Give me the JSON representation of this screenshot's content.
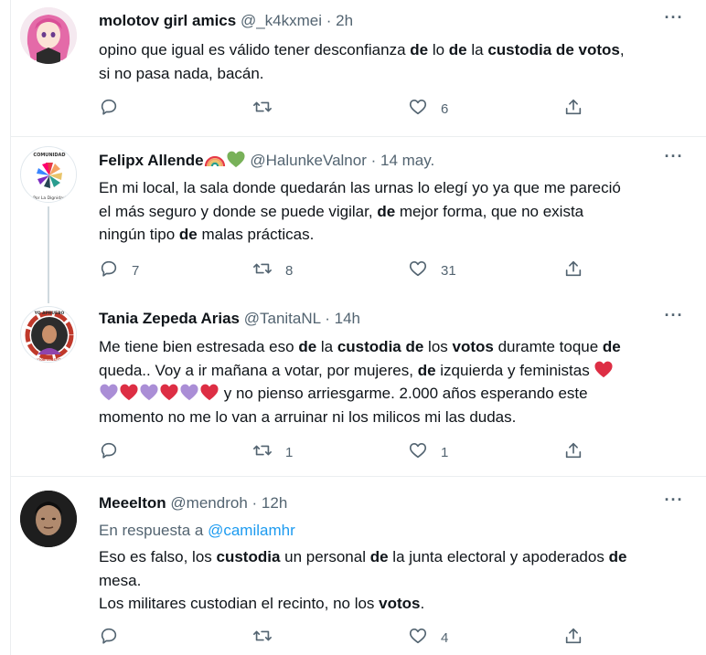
{
  "tweets": [
    {
      "name": "molotov girl amics",
      "handle": "@_k4kxmei",
      "sep": "·",
      "time": "2h",
      "lines": [
        [
          {
            "t": "opino que igual es válido tener desconfianza "
          },
          {
            "b": "de"
          },
          {
            "t": " lo "
          },
          {
            "b": "de"
          },
          {
            "t": " la "
          },
          {
            "b": "custodia de votos"
          },
          {
            "t": ","
          }
        ],
        [
          {
            "t": "si no pasa nada, bacán."
          }
        ]
      ],
      "actions": {
        "reply": "",
        "retweet": "",
        "like": "6"
      }
    },
    {
      "name": "Felipx Allende",
      "handle": "@HalunkeValnor",
      "sep": "·",
      "time": "14 may.",
      "lines": [
        [
          {
            "t": "En mi local, la sala donde quedarán las urnas lo elegí yo ya que me pareció"
          }
        ],
        [
          {
            "t": "el más seguro y donde se puede vigilar, "
          },
          {
            "b": "de"
          },
          {
            "t": " mejor forma, que no exista"
          }
        ],
        [
          {
            "t": "ningún tipo "
          },
          {
            "b": "de"
          },
          {
            "t": " malas prácticas."
          }
        ]
      ],
      "avatar_text": [
        "COMUNIDAD",
        "Por La Dignidad"
      ],
      "actions": {
        "reply": "7",
        "retweet": "8",
        "like": "31"
      }
    },
    {
      "name": "Tania Zepeda Arias",
      "handle": "@TanitaNL",
      "sep": "·",
      "time": "14h",
      "lines": [
        [
          {
            "t": "Me tiene bien estresada eso "
          },
          {
            "b": "de"
          },
          {
            "t": " la "
          },
          {
            "b": "custodia de"
          },
          {
            "t": " los "
          },
          {
            "b": "votos"
          },
          {
            "t": " duramte toque "
          },
          {
            "b": "de"
          }
        ],
        [
          {
            "t": "queda.. Voy a ir mañana a votar, por mujeres, "
          },
          {
            "b": "de"
          },
          {
            "t": " izquierda y feministas "
          }
        ],
        [
          {
            "t": " y no pienso arriesgarme. 2.000 años esperando este"
          }
        ],
        [
          {
            "t": "momento no me lo van a arruinar ni los milicos mi las dudas."
          }
        ]
      ],
      "avatar_text": [
        "YO APRUEBO",
        "CONVENCIÓN CONSTITUCIONAL"
      ],
      "actions": {
        "reply": "",
        "retweet": "1",
        "like": "1"
      }
    },
    {
      "name": "Meeelton",
      "handle": "@mendroh",
      "sep": "·",
      "time": "12h",
      "reply_prefix": "En respuesta a",
      "reply_handle": "@camilamhr",
      "lines": [
        [
          {
            "t": "Eso es falso, los "
          },
          {
            "b": "custodia"
          },
          {
            "t": " un personal "
          },
          {
            "b": "de"
          },
          {
            "t": " la junta electoral y apoderados "
          },
          {
            "b": "de"
          }
        ],
        [
          {
            "t": "mesa."
          }
        ],
        [
          {
            "t": "Los militares custodian el recinto, no los "
          },
          {
            "b": "votos"
          },
          {
            "t": "."
          }
        ]
      ],
      "actions": {
        "reply": "",
        "retweet": "",
        "like": "4"
      }
    }
  ],
  "icons": {
    "more": "more-dots-icon",
    "reply": "reply-bubble-icon",
    "retweet": "retweet-icon",
    "like": "heart-icon",
    "share": "share-upload-icon"
  },
  "colors": {
    "text": "#0f1419",
    "muted": "#536471",
    "link": "#1d9bf0",
    "heart_red": "#dd2e44",
    "heart_purple": "#aa8ed6",
    "heart_green": "#78b159"
  }
}
